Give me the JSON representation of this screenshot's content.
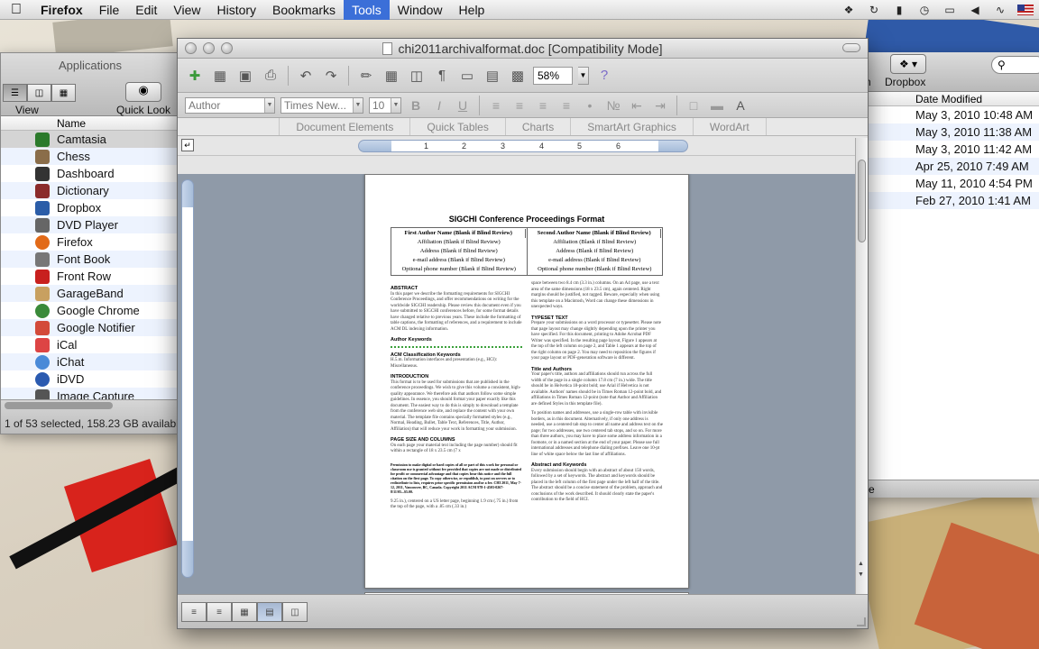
{
  "menubar": {
    "apple_icon": "apple-logo-icon",
    "app_name": "Firefox",
    "menus": [
      "File",
      "Edit",
      "View",
      "History",
      "Bookmarks",
      "Tools",
      "Window",
      "Help"
    ],
    "active_menu": "Tools",
    "status_icons": [
      "dropbox-icon",
      "sync-icon",
      "battery-icon",
      "time-machine-icon",
      "display-icon",
      "volume-icon",
      "wifi-icon",
      "us-flag-icon"
    ]
  },
  "finder_left": {
    "title": "Applications",
    "view_label": "View",
    "quick_look_label": "Quick Look",
    "column_name": "Name",
    "items": [
      {
        "name": "Camtasia",
        "color": "#2b7a2b"
      },
      {
        "name": "Chess",
        "color": "#8a6d4a"
      },
      {
        "name": "Dashboard",
        "color": "#333333"
      },
      {
        "name": "Dictionary",
        "color": "#8b2b2b"
      },
      {
        "name": "Dropbox",
        "color": "#2b5da8"
      },
      {
        "name": "DVD Player",
        "color": "#666666"
      },
      {
        "name": "Firefox",
        "color": "#e26a18"
      },
      {
        "name": "Font Book",
        "color": "#777777"
      },
      {
        "name": "Front Row",
        "color": "#c8201e"
      },
      {
        "name": "GarageBand",
        "color": "#c8a060"
      },
      {
        "name": "Google Chrome",
        "color": "#3a8a3a"
      },
      {
        "name": "Google Notifier",
        "color": "#d34a3a"
      },
      {
        "name": "iCal",
        "color": "#d44"
      },
      {
        "name": "iChat",
        "color": "#4a8ad8"
      },
      {
        "name": "iDVD",
        "color": "#2a5ab0"
      },
      {
        "name": "Image Capture",
        "color": "#555555"
      }
    ],
    "selected_item": "Camtasia",
    "status_text": "1 of 53 selected, 158.23 GB availabl"
  },
  "finder_right": {
    "n_label": "n",
    "dropbox_label": "Dropbox",
    "column_date": "Date Modified",
    "dates": [
      "May 3, 2010 10:48 AM",
      "May 3, 2010 11:38 AM",
      "May 3, 2010 11:42 AM",
      "Apr 25, 2010 7:49 AM",
      "May 11, 2010 4:54 PM",
      "Feb 27, 2010 1:41 AM"
    ],
    "bottom_text": "e"
  },
  "word": {
    "title": "chi2011archivalformat.doc [Compatibility Mode]",
    "zoom": "58%",
    "style_combo": "Author",
    "font_combo": "Times New...",
    "size_combo": "10",
    "format_buttons": [
      "B",
      "I",
      "U"
    ],
    "ribbon_tabs": [
      "Document Elements",
      "Quick Tables",
      "Charts",
      "SmartArt Graphics",
      "WordArt"
    ],
    "ruler_numbers": [
      "1",
      "2",
      "3",
      "4",
      "5",
      "6"
    ],
    "page": {
      "title": "SIGCHI Conference Proceedings Format",
      "author1": {
        "name": "First Author Name (Blank if Blind Review)",
        "affiliation": "Affiliation (Blank if Blind Review)",
        "address": "Address (Blank if Blind Review)",
        "email": "e-mail address (Blank if Blind Review)",
        "phone": "Optional phone number (Blank if Blind Review)"
      },
      "author2": {
        "name": "Second Author Name (Blank if Blind Review)",
        "affiliation": "Affiliation (Blank if Blind Review)",
        "address": "Address (Blank if Blind Review)",
        "email": "e-mail address (Blank if Blind Review)",
        "phone": "Optional phone number (Blank if Blind Review)"
      },
      "left_col": {
        "abstract_h": "ABSTRACT",
        "abstract": "In this paper we describe the formatting requirements for SIGCHI Conference Proceedings, and offer recommendations on writing for the worldwide SIGCHI readership. Please review this document even if you have submitted to SIGCHI conferences before, for some format details have changed relative to previous years. These include the formatting of table captions, the formatting of references, and a requirement to include ACM DL indexing information.",
        "keywords_h": "Author Keywords",
        "acm_h": "ACM Classification Keywords",
        "acm": "H.5.m. Information interfaces and presentation (e.g., HCI): Miscellaneous.",
        "intro_h": "INTRODUCTION",
        "intro": "This format is to be used for submissions that are published in the conference proceedings. We wish to give this volume a consistent, high-quality appearance. We therefore ask that authors follow some simple guidelines. In essence, you should format your paper exactly like this document. The easiest way to do this is simply to download a template from the conference web site, and replace the content with your own material. The template file contains specially formatted styles (e.g., Normal, Heading, Bullet, Table Text, References, Title, Author, Affiliation) that will reduce your work in formatting your submission.",
        "page_h": "PAGE SIZE AND COLUMNS",
        "page": "On each page your material text including the page number) should fit within a rectangle of 18 x 23.5 cm (7 x",
        "copyright": "Permission to make digital or hard copies of all or part of this work for personal or classroom use is granted without fee provided that copies are not made or distributed for profit or commercial advantage and that copies bear this notice and the full citation on the first page. To copy otherwise, or republish, to post on servers or to redistribute to lists, requires prior specific permission and/or a fee. CHI 2011, May 7-12, 2011, Vancouver, BC, Canada. Copyright 2011 ACM 978-1-4503-0267-8/11/05...$5.00.",
        "tail": "9.25 in.), centered on a US letter page, beginning 1.9 cm (.75 in.) from the top of the page, with a .85 cm (.33 in.)"
      },
      "right_col": {
        "intro": "space between two 8.4 cm (3.3 in.) columns. On an A4 page, use a text area of the same dimensions (18 x 23.5 cm), again centered. Right margins should be justified, not ragged. Beware, especially when using this template on a Macintosh, Word can change these dimensions in unexpected ways.",
        "typeset_h": "TYPESET TEXT",
        "typeset": "Prepare your submissions on a word processor or typesetter. Please note that page layout may change slightly depending upon the printer you have specified. For this document, printing to Adobe Acrobat PDF Writer was specified. In the resulting page layout, Figure 1 appears at the top of the left column on page 2, and Table 1 appears at the top of the right column on page 2. You may need to reposition the figures if your page layout or PDF-generation software is different.",
        "title_h": "Title and Authors",
        "title": "Your paper's title, authors and affiliations should run across the full width of the page in a single column 17.8 cm (7 in.) wide. The title should be in Helvetica 18-point bold; use Arial if Helvetica is not available. Authors' names should be in Times Roman 12-point bold, and affiliations in Times Roman 12-point (note that Author and Affiliation are defined Styles in this template file).",
        "title2": "To position names and addresses, use a single-row table with invisible borders, as in this document. Alternatively, if only one address is needed, use a centered tab stop to center all name and address text on the page; for two addresses, use two centered tab stops, and so on. For more than three authors, you may have to place some address information in a footnote, or in a named section at the end of your paper. Please use full international addresses and telephone dialing prefixes. Leave one 10-pt line of white space below the last line of affiliations.",
        "abs_h": "Abstract and Keywords",
        "abs": "Every submission should begin with an abstract of about 150 words, followed by a set of keywords. The abstract and keywords should be placed in the left column of the first page under the left half of the title. The abstract should be a concise statement of the problem, approach and conclusions of the work described. It should clearly state the paper's contribution to the field of HCI."
      }
    }
  }
}
